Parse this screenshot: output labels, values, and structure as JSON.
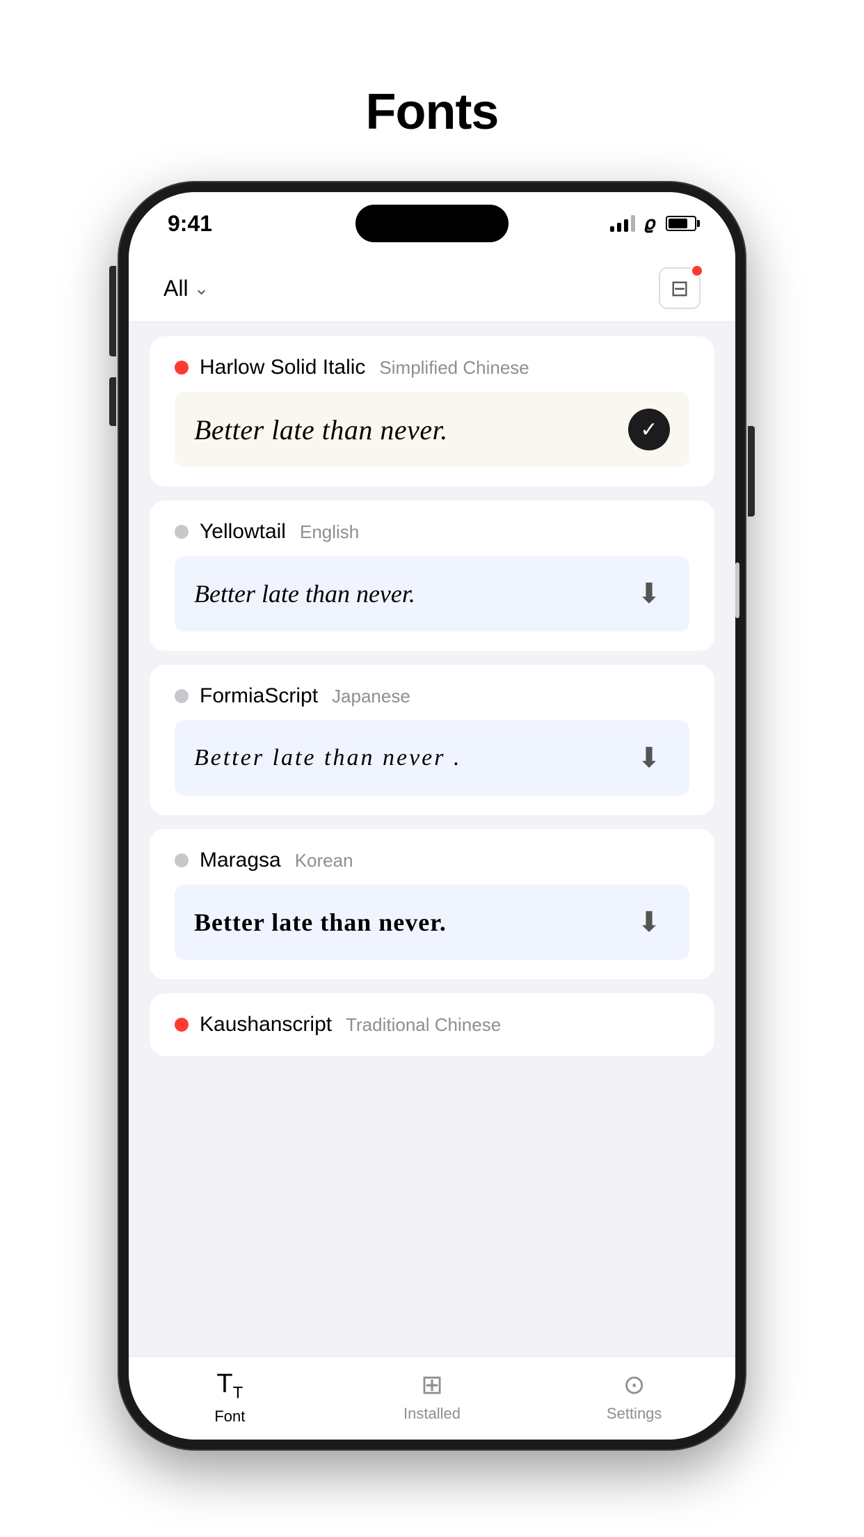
{
  "page": {
    "title": "Fonts"
  },
  "status_bar": {
    "time": "9:41"
  },
  "toolbar": {
    "filter_label": "All",
    "chevron": "▾"
  },
  "fonts": [
    {
      "name": "Harlow Solid Italic",
      "language": "Simplified Chinese",
      "status": "installed",
      "preview_text": "Better late than never.",
      "preview_style": "harlow",
      "preview_bg": "warm",
      "action": "check"
    },
    {
      "name": "Yellowtail",
      "language": "English",
      "status": "not-installed",
      "preview_text": "Better late than never.",
      "preview_style": "yellowtail",
      "preview_bg": "cool",
      "action": "download"
    },
    {
      "name": "FormiaScript",
      "language": "Japanese",
      "status": "not-installed",
      "preview_text": "Better  late  than  never .",
      "preview_style": "formia",
      "preview_bg": "cool",
      "action": "download"
    },
    {
      "name": "Maragsa",
      "language": "Korean",
      "status": "not-installed",
      "preview_text": "Better late than never.",
      "preview_style": "maragsa",
      "preview_bg": "cool",
      "action": "download"
    },
    {
      "name": "Kaushanscript",
      "language": "Traditional Chinese",
      "status": "installed",
      "preview_text": "",
      "preview_style": "",
      "preview_bg": "",
      "action": "partial"
    }
  ],
  "bottom_nav": {
    "items": [
      {
        "label": "Font",
        "icon": "Tт",
        "active": true
      },
      {
        "label": "Installed",
        "icon": "🗂",
        "active": false
      },
      {
        "label": "Settings",
        "icon": "⚙",
        "active": false
      }
    ]
  }
}
